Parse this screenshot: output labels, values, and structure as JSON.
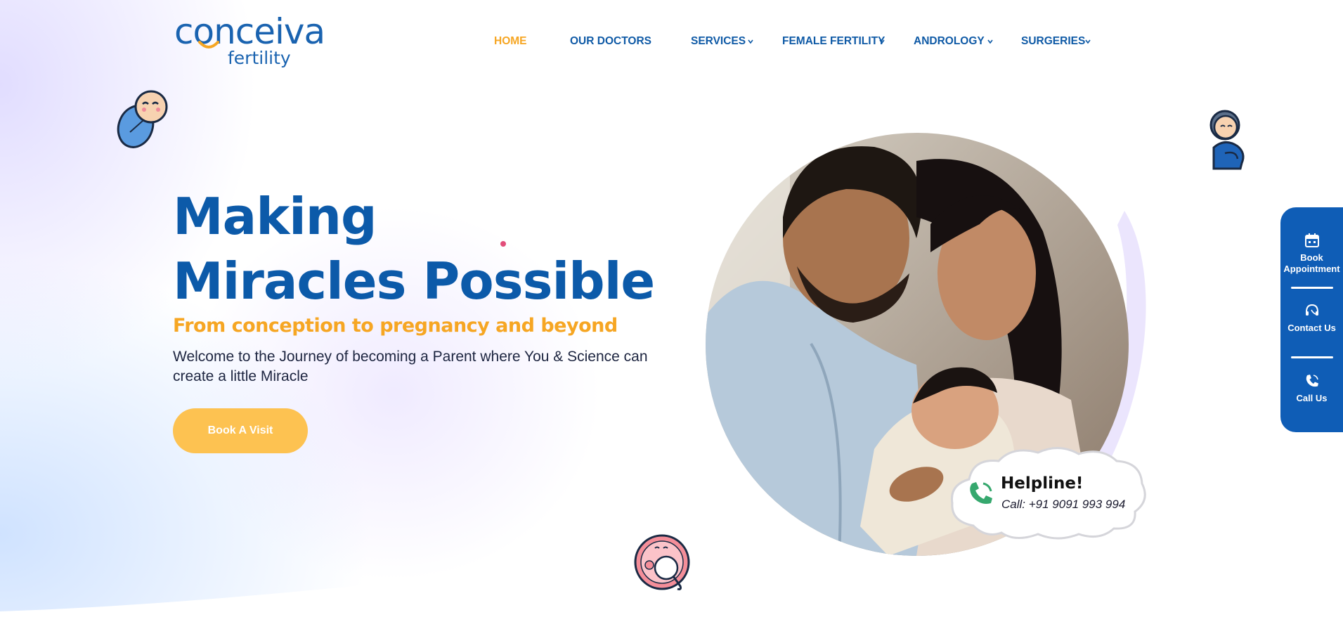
{
  "brand": {
    "logo_word": "conceiva",
    "logo_sub": "fertility",
    "primary_color": "#0c5aa9",
    "accent_color": "#f6a623"
  },
  "nav": {
    "items": [
      {
        "label": "HOME",
        "active": true,
        "dropdown": false
      },
      {
        "label": "OUR DOCTORS",
        "active": false,
        "dropdown": false
      },
      {
        "label": "SERVICES",
        "active": false,
        "dropdown": true
      },
      {
        "label": "FEMALE FERTILITY",
        "active": false,
        "dropdown": true
      },
      {
        "label": "ANDROLOGY",
        "active": false,
        "dropdown": true
      },
      {
        "label": "SURGERIES",
        "active": false,
        "dropdown": true
      }
    ]
  },
  "hero": {
    "title_line1": "Making",
    "title_line2": "Miracles Possible",
    "tagline": "From conception to pregnancy and beyond",
    "intro": "Welcome to the Journey of becoming a Parent where You & Science can create a little Miracle",
    "cta_label": "Book A Visit"
  },
  "helpline": {
    "title": "Helpline!",
    "call_text": "Call: +91 9091 993 994",
    "icon": "phone-icon"
  },
  "side_panel": {
    "items": [
      {
        "label": "Book Appointment",
        "icon": "calendar-icon"
      },
      {
        "label": "Contact Us",
        "icon": "headset-icon"
      },
      {
        "label": "Call Us",
        "icon": "phone-icon"
      }
    ]
  }
}
